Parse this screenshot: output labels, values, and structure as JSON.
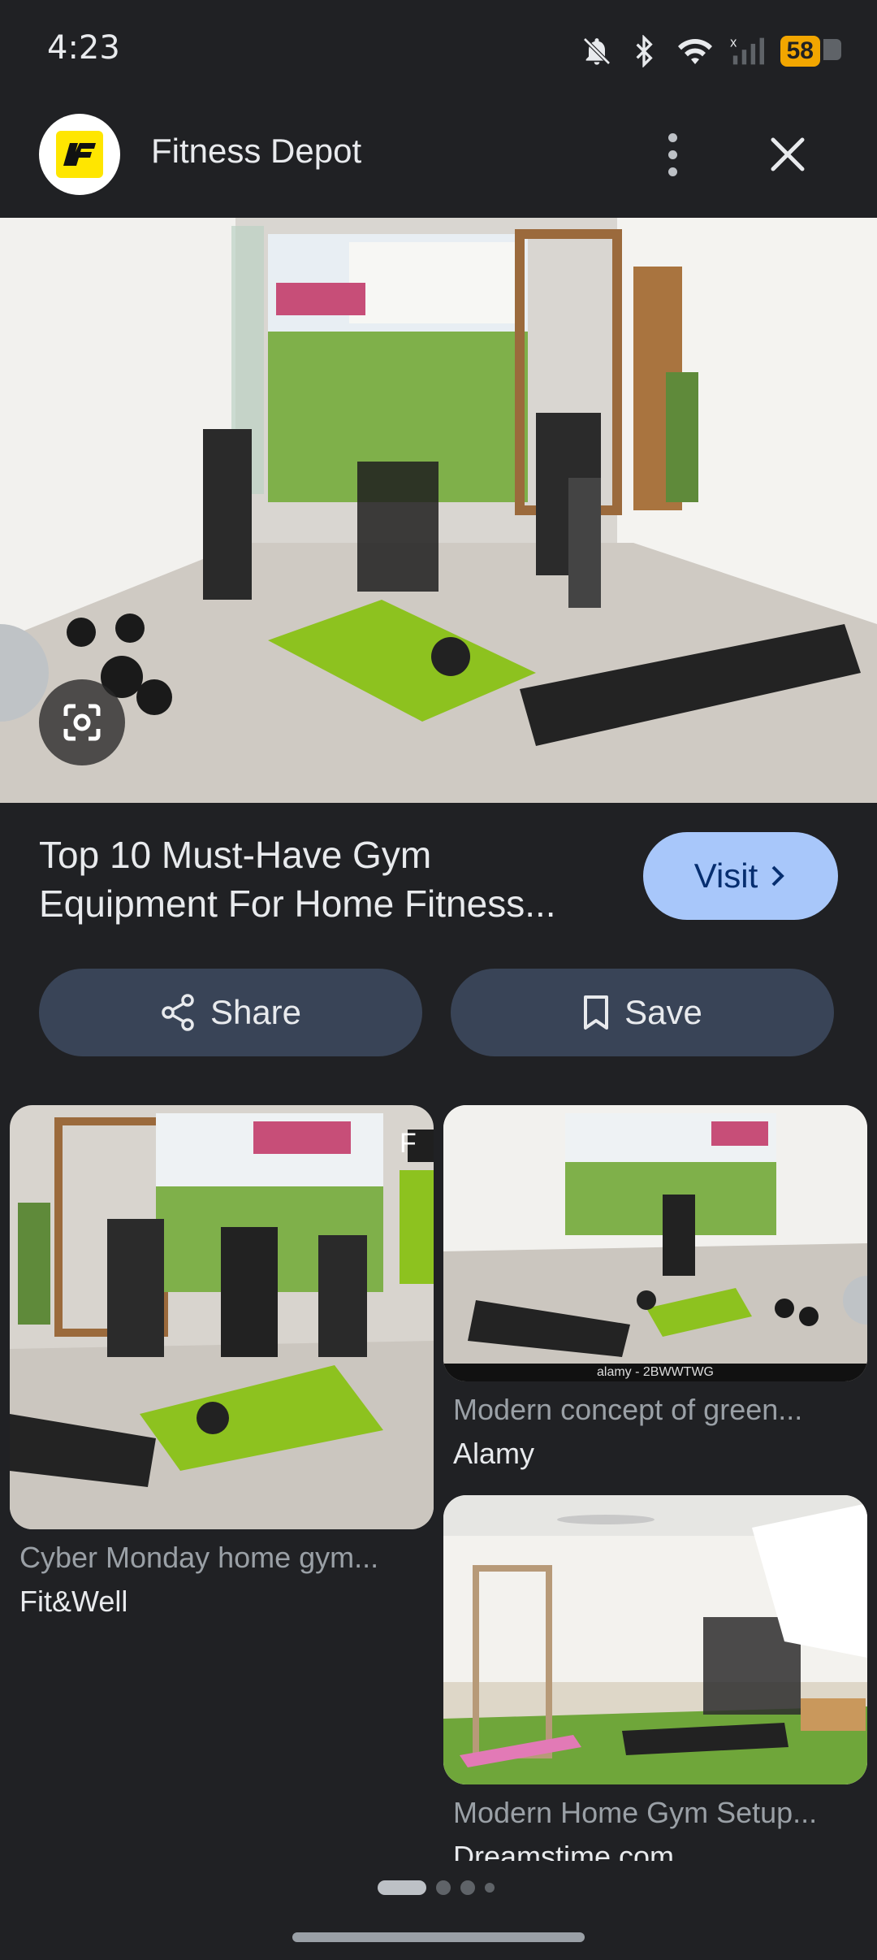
{
  "status": {
    "time": "4:23",
    "battery": "58"
  },
  "header": {
    "site_name": "Fitness Depot"
  },
  "result": {
    "title": "Top 10 Must-Have Gym Equipment For Home Fitness...",
    "visit_label": "Visit",
    "share_label": "Share",
    "save_label": "Save"
  },
  "related": [
    {
      "caption": "Cyber Monday home gym...",
      "source": "Fit&Well",
      "partial_text": "F"
    },
    {
      "caption": "Modern concept of green...",
      "source": "Alamy",
      "watermark": "alamy - 2BWWTWG"
    },
    {
      "caption": "Modern Home Gym Setup...",
      "source": "Dreamstime.com"
    }
  ],
  "colors": {
    "accent": "#a8c7fa",
    "pill": "#394457",
    "background": "#202124",
    "mat": "#8dc21f"
  }
}
